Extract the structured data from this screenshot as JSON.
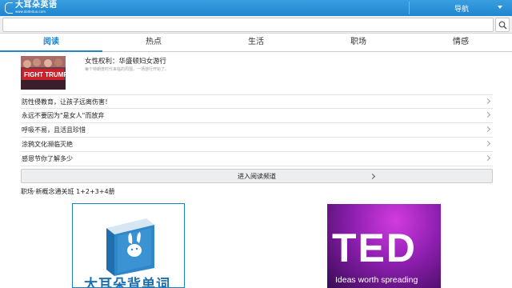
{
  "header": {
    "logo_name": "大耳朵英语",
    "logo_url": "www.dadeduo.com",
    "nav_label": "导航"
  },
  "search": {
    "placeholder": ""
  },
  "tabs": [
    {
      "label": "阅读",
      "active": true
    },
    {
      "label": "热点",
      "active": false
    },
    {
      "label": "生活",
      "active": false
    },
    {
      "label": "职场",
      "active": false
    },
    {
      "label": "情感",
      "active": false
    }
  ],
  "featured": {
    "title": "女性权利：华盛顿妇女游行",
    "description": "每个特朗普时代来临的周围，一场游行开始了。",
    "thumb_caption": "FIGHT TRUMP"
  },
  "articles": [
    {
      "label": "防性侵教育，让孩子远离伤害！"
    },
    {
      "label": "永远不要因为\"是女人\"而放弃"
    },
    {
      "label": "呼吸不易，且活且珍惜"
    },
    {
      "label": "涂鸦文化濒临灭绝"
    },
    {
      "label": "感恩节你了解多少"
    }
  ],
  "enter_button": "进入阅读频道",
  "section_title": "职场·新概念通关班 1+2+3+4册",
  "cards": {
    "left_caption": "大耳朵背单词",
    "right_title": "TED",
    "right_tagline": "Ideas worth spreading"
  },
  "colors": {
    "brand_blue": "#1f86cf",
    "ted_purple": "#8e1fb0"
  }
}
